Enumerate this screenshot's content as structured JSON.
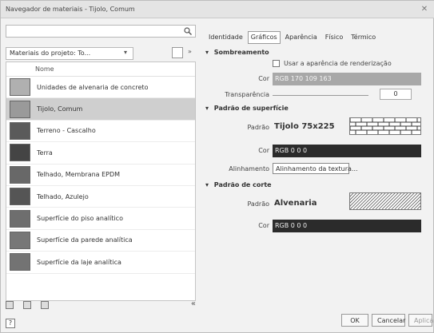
{
  "window": {
    "title": "Navegador de materiais - Tijolo, Comum"
  },
  "search": {
    "placeholder": ""
  },
  "filter": {
    "label": "Materiais do projeto: To..."
  },
  "list": {
    "header": "Nome",
    "items": [
      {
        "label": "Unidades de alvenaria de concreto",
        "swatch": "#b0b0b0",
        "selected": false
      },
      {
        "label": "Tijolo, Comum",
        "swatch": "#9a9a9a",
        "selected": true
      },
      {
        "label": "Terreno - Cascalho",
        "swatch": "#5a5a5a",
        "selected": false
      },
      {
        "label": "Terra",
        "swatch": "#444444",
        "selected": false
      },
      {
        "label": "Telhado, Membrana EPDM",
        "swatch": "#686868",
        "selected": false
      },
      {
        "label": "Telhado, Azulejo",
        "swatch": "#555555",
        "selected": false
      },
      {
        "label": "Superfície do piso analítico",
        "swatch": "#6e6e6e",
        "selected": false
      },
      {
        "label": "Superfície da parede analítica",
        "swatch": "#777777",
        "selected": false
      },
      {
        "label": "Superfície da laje analítica",
        "swatch": "#737373",
        "selected": false
      }
    ]
  },
  "tabs": [
    "Identidade",
    "Gráficos",
    "Aparência",
    "Físico",
    "Térmico"
  ],
  "active_tab": "Gráficos",
  "shading": {
    "title": "Sombreamento",
    "use_render_label": "Usar a aparência de renderização",
    "color_label": "Cor",
    "color_value": "RGB 170 109 163",
    "color_hex": "#a8a8a8",
    "transparency_label": "Transparência",
    "transparency_value": "0"
  },
  "surface_pattern": {
    "title": "Padrão de superfície",
    "pattern_label": "Padrão",
    "pattern_value": "Tijolo 75x225",
    "color_label": "Cor",
    "color_value": "RGB 0 0 0",
    "alignment_label": "Alinhamento",
    "alignment_value": "Alinhamento da textura..."
  },
  "cut_pattern": {
    "title": "Padrão de corte",
    "pattern_label": "Padrão",
    "pattern_value": "Alvenaria",
    "color_label": "Cor",
    "color_value": "RGB 0 0 0"
  },
  "buttons": {
    "ok": "OK",
    "cancel": "Cancelar",
    "apply": "Aplicar"
  },
  "colors": {
    "dark_bar": "#2b2b2b"
  }
}
